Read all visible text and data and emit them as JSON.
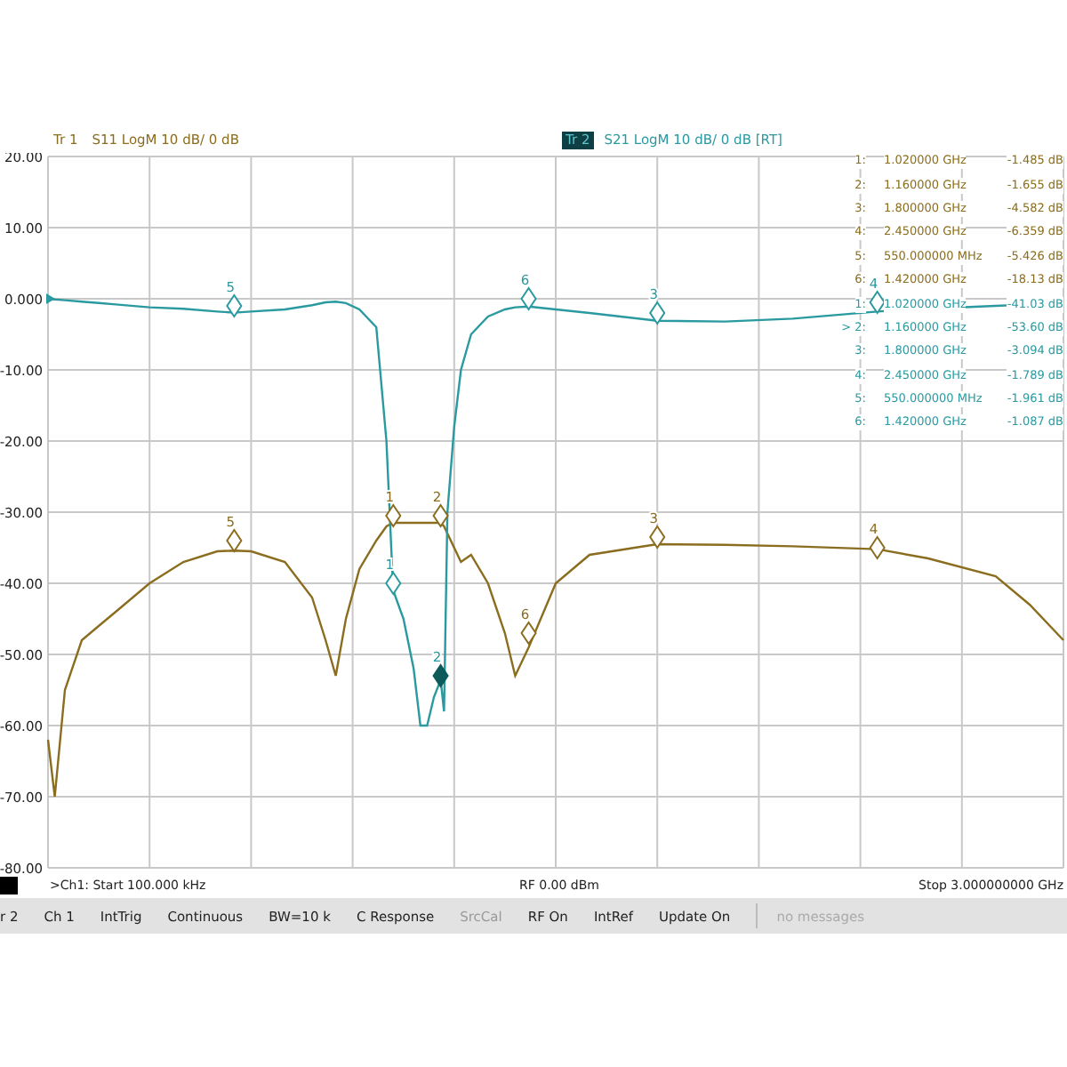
{
  "traces": [
    {
      "badge": "Tr 1",
      "label": "S11 LogM 10 dB/ 0 dB",
      "selected": false,
      "color": "#8a6d1e",
      "markers": [
        {
          "label": "5",
          "selected": false
        },
        {
          "label": "1",
          "selected": false
        },
        {
          "label": "2",
          "selected": false
        },
        {
          "label": "6",
          "selected": false
        },
        {
          "label": "3",
          "selected": false
        },
        {
          "label": "4",
          "selected": false
        }
      ]
    },
    {
      "badge": "Tr 2",
      "label": "S21 LogM 10 dB/ 0 dB [RT]",
      "selected": true,
      "color": "#2a9aa0",
      "markers": [
        {
          "label": "5",
          "selected": false
        },
        {
          "label": "1",
          "selected": false
        },
        {
          "label": "2",
          "selected": true
        },
        {
          "label": "6",
          "selected": false
        },
        {
          "label": "3",
          "selected": false
        },
        {
          "label": "4",
          "selected": false
        }
      ]
    }
  ],
  "y_axis_labels": [
    "20.00",
    "10.00",
    "0.000",
    "-10.00",
    "-20.00",
    "-30.00",
    "-40.00",
    "-50.00",
    "-60.00",
    "-70.00",
    "-80.00"
  ],
  "marker_tables": [
    {
      "color": "#8a6d1e",
      "rows": [
        {
          "label": "1:",
          "frequency": "1.020000 GHz",
          "value": "-1.485 dB"
        },
        {
          "label": "2:",
          "frequency": "1.160000 GHz",
          "value": "-1.655 dB"
        },
        {
          "label": "3:",
          "frequency": "1.800000 GHz",
          "value": "-4.582 dB"
        },
        {
          "label": "4:",
          "frequency": "2.450000 GHz",
          "value": "-6.359 dB"
        },
        {
          "label": "5:",
          "frequency": "550.000000 MHz",
          "value": "-5.426 dB"
        },
        {
          "label": "6:",
          "frequency": "1.420000 GHz",
          "value": "-18.13 dB"
        }
      ]
    },
    {
      "color": "#2a9aa0",
      "rows": [
        {
          "label": "1:",
          "frequency": "1.020000 GHz",
          "value": "-41.03 dB"
        },
        {
          "label": "> 2:",
          "frequency": "1.160000 GHz",
          "value": "-53.60 dB"
        },
        {
          "label": "3:",
          "frequency": "1.800000 GHz",
          "value": "-3.094 dB"
        },
        {
          "label": "4:",
          "frequency": "2.450000 GHz",
          "value": "-1.789 dB"
        },
        {
          "label": "5:",
          "frequency": "550.000000 MHz",
          "value": "-1.961 dB"
        },
        {
          "label": "6:",
          "frequency": "1.420000 GHz",
          "value": "-1.087 dB"
        }
      ]
    }
  ],
  "footer": {
    "start": ">Ch1: Start 100.000 kHz",
    "power": "RF 0.00 dBm",
    "stop": "Stop 3.000000000 GHz"
  },
  "status_bar": {
    "items": [
      {
        "label": "r 2",
        "disabled": false
      },
      {
        "label": "Ch 1",
        "disabled": false
      },
      {
        "label": "IntTrig",
        "disabled": false
      },
      {
        "label": "Continuous",
        "disabled": false
      },
      {
        "label": "BW=10 k",
        "disabled": false
      },
      {
        "label": "C Response",
        "disabled": false
      },
      {
        "label": "SrcCal",
        "disabled": true
      },
      {
        "label": "RF On",
        "disabled": false
      },
      {
        "label": "IntRef",
        "disabled": false
      },
      {
        "label": "Update On",
        "disabled": false
      }
    ],
    "message": "no messages"
  }
}
